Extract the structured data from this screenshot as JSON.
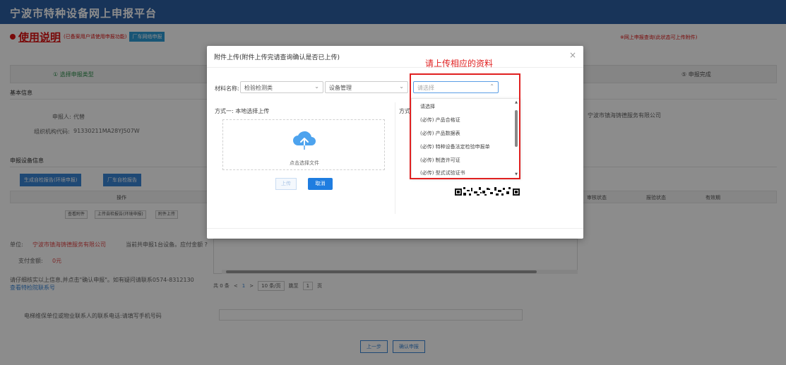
{
  "app": {
    "title": "宁波市特种设备网上申报平台"
  },
  "help": {
    "title": "使用说明",
    "subtitle": "(已备案用户请使用申报功能)",
    "badge": "厂车网络申报"
  },
  "top_right_note": "※网上申报查询(此状态可上传附件)",
  "steps": {
    "step1": "① 选择申报类型",
    "step5": "⑤ 申报完成"
  },
  "background": {
    "basic_info": "基本信息",
    "applicant_label": "申报人:",
    "applicant_value": "代替",
    "org_label": "组织机构代码:",
    "org_value": "91330211MA28YJ507W",
    "company": "宁波市镇海铸德服务有限公司",
    "equipment_info": "申报设备信息",
    "btn_generate": "生成自检报告(环境申报)",
    "btn_factory": "厂车自检报告",
    "col_operation": "操作",
    "col_status1": "审核状态",
    "col_status2": "报验状态",
    "col_valid": "有效期",
    "row_btn1": "查看附件",
    "row_btn2": "上传自检报告(环境申报)",
    "row_btn3": "附件上传",
    "notice_prefix": "单位:",
    "notice_company": "宁波市镇海铸德服务有限公司",
    "notice_suffix": "当前共申报1台设备。应付金额 ?",
    "pay_label": "支付金额:",
    "pay_value": "0元",
    "confirm_text": "请仔细核实以上信息,并点击\"确认申报\"。如有疑问请联系0574-8312130",
    "contact_link": "查看特检院联系号",
    "phone_label": "电梯维保单位或物业联系人的联系电话:请填写手机号码",
    "btn_prev": "上一步",
    "btn_confirm": "确认申报"
  },
  "pager": {
    "total": "共 0 条",
    "prev": "<",
    "page": "1",
    "next": ">",
    "per_page": "10 条/页",
    "goto_label": "跳至",
    "goto_value": "1",
    "page_unit": "页"
  },
  "modal": {
    "title": "附件上传(附件上传完请查询确认是否已上传)",
    "close": "×",
    "material_label": "材料名称:",
    "select1": "检验检测类",
    "select2": "设备管理",
    "select3_placeholder": "请选择",
    "method1": "方式一: 本地选择上传",
    "method2": "方式二",
    "upload_text": "点击选择文件",
    "btn_upload": "上传",
    "btn_cancel": "取消",
    "dropdown_items": [
      "请选择",
      "(必传) 产品合格证",
      "(必传) 产品数据表",
      "(必传) 特种设备法定检验申报单",
      "(必传) 制造许可证",
      "(必传) 型式试验证书"
    ]
  },
  "annotation": {
    "label": "请上传相应的资料",
    "color": "#e02020"
  },
  "colors": {
    "header": "#2d5fa3",
    "primary": "#1f7de0"
  }
}
